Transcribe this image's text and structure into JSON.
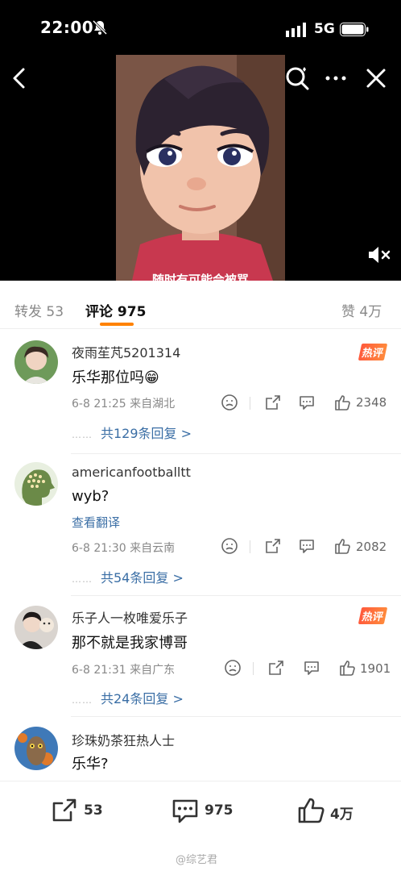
{
  "status": {
    "time": "22:00",
    "network": "5G"
  },
  "video": {
    "caption": "随时有可能会被骂"
  },
  "tabs": {
    "repost": "转发 53",
    "comments": "评论 975",
    "likes": "赞 4万"
  },
  "comments": [
    {
      "username": "夜雨苼芃5201314",
      "text": "乐华那位吗😁",
      "hot_badge": "热评",
      "meta": "6-8 21:25  来自湖北",
      "likes": "2348",
      "replies": "共129条回复 >",
      "reply_dots": "……"
    },
    {
      "username": "americanfootballtt",
      "text": "wyb?",
      "translate": "查看翻译",
      "meta": "6-8 21:30  来自云南",
      "likes": "2082",
      "replies": "共54条回复 >",
      "reply_dots": "……"
    },
    {
      "username": "乐子人一枚唯爱乐子",
      "text": "那不就是我家博哥",
      "hot_badge": "热评",
      "meta": "6-8 21:31  来自广东",
      "likes": "1901",
      "replies": "共24条回复 >",
      "reply_dots": "……"
    },
    {
      "username": "珍珠奶茶狂热人士",
      "text": "乐华?"
    }
  ],
  "bottom_bar": {
    "repost": "53",
    "comment": "975",
    "like": "4万",
    "watermark": "@综艺君"
  },
  "colors": {
    "accent": "#ff8200",
    "link": "#3a6ea5",
    "hot": "#ff5a3c"
  },
  "icons": [
    "bell-muted-icon",
    "signal-icon",
    "battery-icon",
    "back-icon",
    "search-icon",
    "more-icon",
    "close-icon",
    "mute-icon",
    "repost-icon",
    "comment-icon",
    "like-icon",
    "dislike-icon"
  ]
}
